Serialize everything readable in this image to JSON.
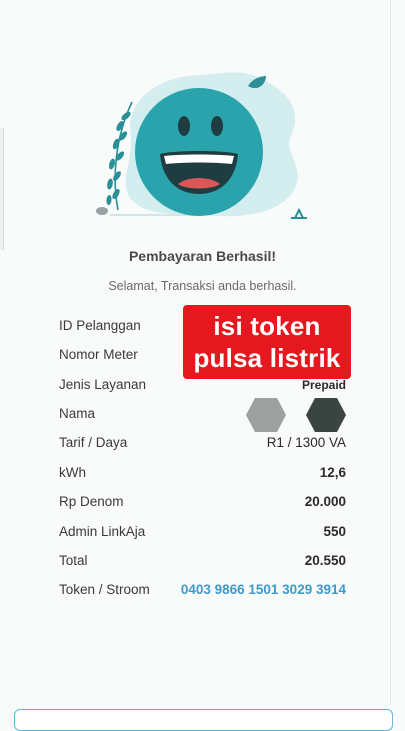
{
  "result": {
    "title": "Pembayaran Berhasil!",
    "subtitle": "Selamat, Transaksi anda berhasil."
  },
  "details": {
    "id_pelanggan": {
      "label": "ID Pelanggan",
      "value": ""
    },
    "nomor_meter": {
      "label": "Nomor Meter",
      "value": ""
    },
    "jenis_layanan": {
      "label": "Jenis Layanan",
      "value": "Prepaid"
    },
    "nama": {
      "label": "Nama"
    },
    "tarif_daya": {
      "label": "Tarif / Daya",
      "value": "R1 / 1300 VA"
    },
    "kwh": {
      "label": "kWh",
      "value": "12,6"
    },
    "rp_denom": {
      "label": "Rp Denom",
      "value": "20.000"
    },
    "admin": {
      "label": "Admin LinkAja",
      "value": "550"
    },
    "total": {
      "label": "Total",
      "value": "20.550"
    },
    "token": {
      "label": "Token / Stroom",
      "value": "0403 9866 1501 3029 3914"
    }
  },
  "overlay": {
    "line1": "isi token",
    "line2": "pulsa listrik"
  },
  "colors": {
    "smiley": "#2aa3ad",
    "splash": "#d4eef0",
    "leaf": "#2a8f96",
    "token_link": "#3d9ac9",
    "overlay_bg": "#e4181e"
  }
}
